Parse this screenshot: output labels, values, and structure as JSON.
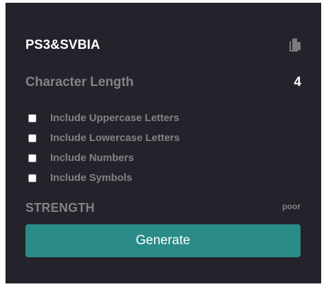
{
  "password": {
    "value": "PS3&SVBIA",
    "copy_icon": "copy-icon"
  },
  "length": {
    "label": "Character Length",
    "value": "4"
  },
  "options": [
    {
      "label": "Include Uppercase Letters",
      "checked": false
    },
    {
      "label": "Include Lowercase Letters",
      "checked": false
    },
    {
      "label": "Include Numbers",
      "checked": false
    },
    {
      "label": "Include Symbols",
      "checked": false
    }
  ],
  "strength": {
    "label": "STRENGTH",
    "value": "poor"
  },
  "generate": {
    "label": "Generate"
  },
  "colors": {
    "card_background": "#24232b",
    "muted_text": "#838286",
    "primary_text": "#ffffff",
    "accent": "#2a8b88",
    "icon": "#7c7b80"
  }
}
